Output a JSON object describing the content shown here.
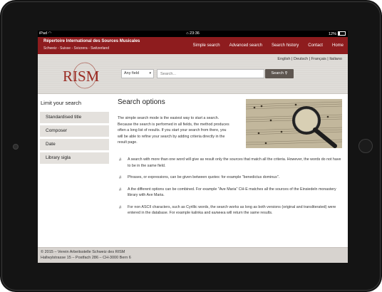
{
  "status_bar": {
    "left": "iPad ",
    "time": "23:36",
    "battery": "12%"
  },
  "site": {
    "title": "Répertoire International des Sources Musicales",
    "subtitle": "Schweiz - Suisse - Svizzera - Switzerland"
  },
  "nav": [
    "Simple search",
    "Advanced search",
    "Search history",
    "Contact",
    "Home"
  ],
  "languages": [
    "English",
    "Deutsch",
    "Français",
    "Italiano"
  ],
  "logo_text": "RISM",
  "search": {
    "field": "Any field",
    "placeholder": "Search...",
    "button": "Search"
  },
  "sidebar": {
    "heading": "Limit your search",
    "facets": [
      "Standardised title",
      "Composer",
      "Date",
      "Library sigla"
    ]
  },
  "main": {
    "heading": "Search options",
    "intro": "The simple search mode is the easiest way to start a search. Because the search is performed in all fields, the method produces often a long list of results. If you start your search from there, you will be able to refine your search by adding criteria directly in the result page.",
    "bullets": [
      "A search with more than one word will give as result only the sources that match all the criteria. However, the words do not have to be in the same field.",
      "Phrases, or expressions, can be given between quotes: for example \"benedictus dominus\".",
      "A the different options can be combined. For example \"Ave Maria\" CH-E matches all the sources of the Einsiedeln monastery library with Ave Maria.",
      "For non ASCII characters, such as Cyrillic words, the search works as long as both versions (original and transliterated) were entered in the database. For example kalinka and калинка will return the same results."
    ]
  },
  "footer": {
    "line1": "© 2015 – Verein Arbeitsstelle Schweiz des RISM",
    "line2": "Hallwylstrasse 15 – Postfach 286 – CH-3000 Bern 6"
  },
  "colors": {
    "brand": "#8e1c1e",
    "header_bg": "#dcd9d5",
    "logo": "#9a2a22"
  }
}
